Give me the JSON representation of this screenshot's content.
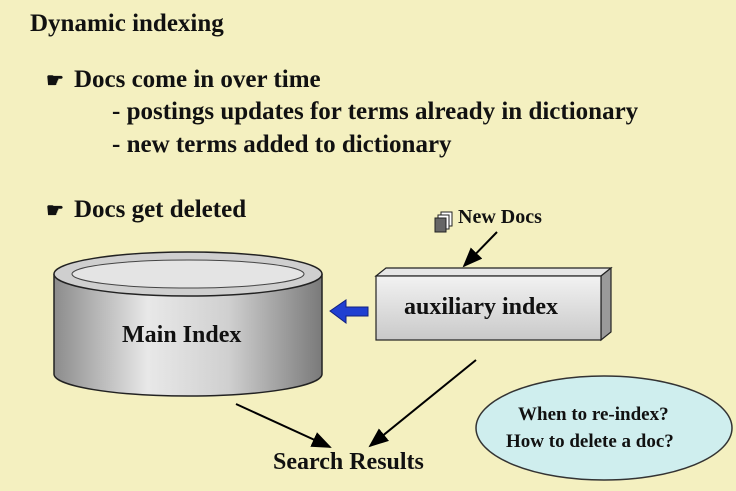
{
  "title": "Dynamic indexing",
  "bullets": [
    {
      "text": "Docs come in over time",
      "subs": [
        "- postings updates for terms already in dictionary",
        "- new terms added to dictionary"
      ]
    },
    {
      "text": "Docs get deleted",
      "subs": []
    }
  ],
  "diagram": {
    "main_index": "Main Index",
    "auxiliary_index": "auxiliary index",
    "new_docs": "New Docs",
    "search_results": "Search Results",
    "bubble": [
      "When to re-index?",
      "How to delete a doc?"
    ]
  },
  "icons": {
    "bullet": "pointing-hand-icon",
    "new_docs": "document-stack-icon",
    "merge_arrow": "left-arrow-icon"
  },
  "colors": {
    "background": "#f4f0c0",
    "arrow_blue": "#1f3fd1",
    "bubble_fill": "#cfeeee"
  }
}
